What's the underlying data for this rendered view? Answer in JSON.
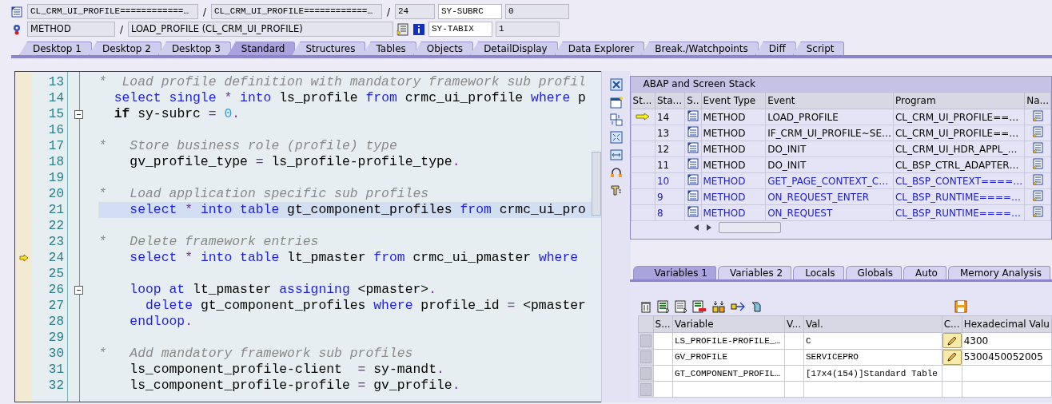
{
  "header": {
    "row1": {
      "program": "CL_CRM_UI_PROFILE============…",
      "separators": [
        "/",
        "/"
      ],
      "include": "CL_CRM_UI_PROFILE============…",
      "line": "24",
      "sys_field": "SY-SUBRC",
      "sys_value": "0"
    },
    "row2": {
      "event_type": "METHOD",
      "separator": "/",
      "event": "LOAD_PROFILE (CL_CRM_UI_PROFILE)",
      "sys_field": "SY-TABIX",
      "sys_value": "1"
    }
  },
  "tabs": [
    {
      "label": "Desktop 1",
      "selected": false
    },
    {
      "label": "Desktop 2",
      "selected": false
    },
    {
      "label": "Desktop 3",
      "selected": false
    },
    {
      "label": "Standard",
      "selected": true
    },
    {
      "label": "Structures",
      "selected": false
    },
    {
      "label": "Tables",
      "selected": false
    },
    {
      "label": "Objects",
      "selected": false
    },
    {
      "label": "DetailDisplay",
      "selected": false
    },
    {
      "label": "Data Explorer",
      "selected": false
    },
    {
      "label": "Break./Watchpoints",
      "selected": false
    },
    {
      "label": "Diff",
      "selected": false
    },
    {
      "label": "Script",
      "selected": false
    }
  ],
  "code": [
    {
      "number": "13",
      "current": false,
      "highlighted": false,
      "foldable": false,
      "segments": [
        {
          "kind": "cmt",
          "text": "*  Load profile definition with mandatory framework sub profil"
        }
      ]
    },
    {
      "number": "14",
      "current": false,
      "highlighted": false,
      "foldable": false,
      "segments": [
        {
          "kind": "kw",
          "text": "  select single"
        },
        {
          "kind": "op",
          "text": " * "
        },
        {
          "kind": "kw",
          "text": "into"
        },
        {
          "kind": "txt",
          "text": " ls_profile "
        },
        {
          "kind": "kw",
          "text": "from"
        },
        {
          "kind": "txt",
          "text": " crmc_ui_profile "
        },
        {
          "kind": "kw",
          "text": "where"
        },
        {
          "kind": "txt",
          "text": " p"
        }
      ]
    },
    {
      "number": "15",
      "current": false,
      "highlighted": false,
      "foldable": true,
      "segments": [
        {
          "kind": "bold",
          "text": "  if"
        },
        {
          "kind": "txt",
          "text": " sy-subrc "
        },
        {
          "kind": "op",
          "text": "="
        },
        {
          "kind": "num",
          "text": " 0"
        },
        {
          "kind": "op",
          "text": "."
        }
      ]
    },
    {
      "number": "16",
      "current": false,
      "foldable": false
    },
    {
      "number": "17",
      "current": false,
      "highlighted": false,
      "foldable": false,
      "segments": [
        {
          "kind": "cmt",
          "text": "*   Store business role (profile) type"
        }
      ]
    },
    {
      "number": "18",
      "current": false,
      "highlighted": false,
      "foldable": false,
      "segments": [
        {
          "kind": "txt",
          "text": "    gv_profile_type "
        },
        {
          "kind": "op",
          "text": "="
        },
        {
          "kind": "txt",
          "text": " ls_profile-profile_type"
        },
        {
          "kind": "op",
          "text": "."
        }
      ]
    },
    {
      "number": "19",
      "current": false,
      "foldable": false
    },
    {
      "number": "20",
      "current": false,
      "highlighted": false,
      "foldable": false,
      "segments": [
        {
          "kind": "cmt",
          "text": "*   Load application specific sub profiles"
        }
      ]
    },
    {
      "number": "21",
      "current": false,
      "highlighted": true,
      "foldable": false,
      "segments": [
        {
          "kind": "kw",
          "text": "    select"
        },
        {
          "kind": "op",
          "text": " * "
        },
        {
          "kind": "kw",
          "text": "into table"
        },
        {
          "kind": "txt",
          "text": " gt_component_profiles "
        },
        {
          "kind": "kw",
          "text": "from"
        },
        {
          "kind": "txt",
          "text": " crmc_ui_pro"
        }
      ]
    },
    {
      "number": "22",
      "current": false,
      "foldable": false
    },
    {
      "number": "23",
      "current": false,
      "highlighted": false,
      "foldable": false,
      "segments": [
        {
          "kind": "cmt",
          "text": "*   Delete framework entries"
        }
      ]
    },
    {
      "number": "24",
      "current": true,
      "highlighted": false,
      "foldable": false,
      "segments": [
        {
          "kind": "kw",
          "text": "    select"
        },
        {
          "kind": "op",
          "text": " * "
        },
        {
          "kind": "kw",
          "text": "into table"
        },
        {
          "kind": "txt",
          "text": " lt_pmaster "
        },
        {
          "kind": "kw",
          "text": "from"
        },
        {
          "kind": "txt",
          "text": " crmc_ui_pmaster "
        },
        {
          "kind": "kw",
          "text": "where"
        }
      ]
    },
    {
      "number": "25",
      "current": false,
      "foldable": false
    },
    {
      "number": "26",
      "current": false,
      "highlighted": false,
      "foldable": true,
      "segments": [
        {
          "kind": "kw",
          "text": "    loop at"
        },
        {
          "kind": "txt",
          "text": " lt_pmaster "
        },
        {
          "kind": "kw",
          "text": "assigning"
        },
        {
          "kind": "txt",
          "text": " <pmaster>"
        },
        {
          "kind": "op",
          "text": "."
        }
      ]
    },
    {
      "number": "27",
      "current": false,
      "highlighted": false,
      "foldable": false,
      "segments": [
        {
          "kind": "kw",
          "text": "      delete"
        },
        {
          "kind": "txt",
          "text": " gt_component_profiles "
        },
        {
          "kind": "kw",
          "text": "where"
        },
        {
          "kind": "txt",
          "text": " profile_id "
        },
        {
          "kind": "op",
          "text": "="
        },
        {
          "kind": "txt",
          "text": " <pmaster"
        }
      ]
    },
    {
      "number": "28",
      "current": false,
      "highlighted": false,
      "foldable": false,
      "segments": [
        {
          "kind": "kw",
          "text": "    endloop"
        },
        {
          "kind": "op",
          "text": "."
        }
      ]
    },
    {
      "number": "29",
      "current": false,
      "foldable": false
    },
    {
      "number": "30",
      "current": false,
      "highlighted": false,
      "foldable": false,
      "segments": [
        {
          "kind": "cmt",
          "text": "*   Add mandatory framework sub profiles"
        }
      ]
    },
    {
      "number": "31",
      "current": false,
      "highlighted": false,
      "foldable": false,
      "segments": [
        {
          "kind": "txt",
          "text": "    ls_component_profile-client  "
        },
        {
          "kind": "op",
          "text": "="
        },
        {
          "kind": "txt",
          "text": " sy-mandt"
        },
        {
          "kind": "op",
          "text": "."
        }
      ]
    },
    {
      "number": "32",
      "current": false,
      "highlighted": false,
      "foldable": false,
      "segments": [
        {
          "kind": "txt",
          "text": "    ls_component_profile-profile "
        },
        {
          "kind": "op",
          "text": "="
        },
        {
          "kind": "txt",
          "text": " gv_profile"
        },
        {
          "kind": "op",
          "text": "."
        }
      ]
    }
  ],
  "stack": {
    "title": "ABAP and Screen Stack",
    "columns": [
      "St...",
      "Sta...",
      "S..",
      "Event Type",
      "Event",
      "Program",
      "Na..."
    ],
    "rows": [
      {
        "current": true,
        "level": "14",
        "event_type": "METHOD",
        "event": "LOAD_PROFILE",
        "program": "CL_CRM_UI_PROFILE==…",
        "color": "#000000"
      },
      {
        "current": false,
        "level": "13",
        "event_type": "METHOD",
        "event": "IF_CRM_UI_PROFILE~SE…",
        "program": "CL_CRM_UI_PROFILE==…",
        "color": "#000000"
      },
      {
        "current": false,
        "level": "12",
        "event_type": "METHOD",
        "event": "DO_INIT",
        "program": "CL_CRM_UI_HDR_APPL_…",
        "color": "#000000"
      },
      {
        "current": false,
        "level": "11",
        "event_type": "METHOD",
        "event": "DO_INIT",
        "program": "CL_BSP_CTRL_ADAPTER…",
        "color": "#000000"
      },
      {
        "current": false,
        "level": "10",
        "event_type": "METHOD",
        "event": "GET_PAGE_CONTEXT_C…",
        "program": "CL_BSP_CONTEXT====…",
        "color": "#1a1ad0"
      },
      {
        "current": false,
        "level": "9",
        "event_type": "METHOD",
        "event": "ON_REQUEST_ENTER",
        "program": "CL_BSP_RUNTIME====…",
        "color": "#1a1ad0"
      },
      {
        "current": false,
        "level": "8",
        "event_type": "METHOD",
        "event": "ON_REQUEST",
        "program": "CL_BSP_RUNTIME====…",
        "color": "#1a1ad0"
      }
    ]
  },
  "var_tabs": [
    {
      "label": "Variables 1",
      "selected": true
    },
    {
      "label": "Variables 2",
      "selected": false
    },
    {
      "label": "Locals",
      "selected": false
    },
    {
      "label": "Globals",
      "selected": false
    },
    {
      "label": "Auto",
      "selected": false
    },
    {
      "label": "Memory Analysis",
      "selected": false
    }
  ],
  "variables": {
    "columns": [
      "S...",
      "Variable",
      "V...",
      "Val.",
      "C...",
      "Hexadecimal Valu"
    ],
    "rows": [
      {
        "variable": "LS_PROFILE-PROFILE_…",
        "value": "C",
        "editable": true,
        "hex": "4300"
      },
      {
        "variable": "GV_PROFILE",
        "value": "SERVICEPRO",
        "editable": true,
        "hex": "5300450052005"
      },
      {
        "variable": "GT_COMPONENT_PROFIL…",
        "value": "[17x4(154)]Standard Table",
        "editable": false
      }
    ]
  }
}
